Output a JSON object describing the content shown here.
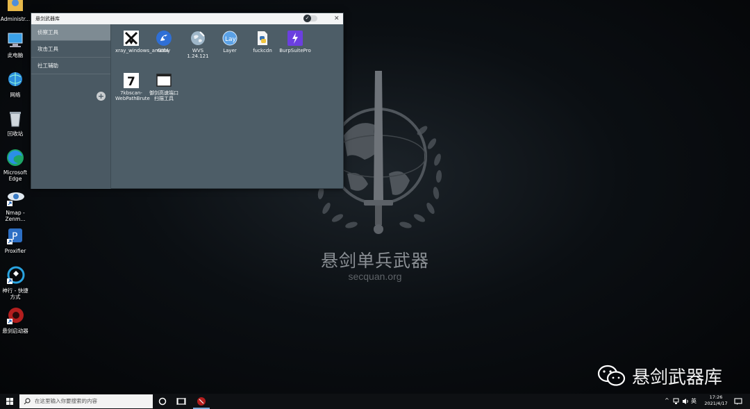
{
  "desktop": {
    "icons": [
      {
        "label": "Administr...",
        "icon": "user-folder-icon"
      },
      {
        "label": "此电脑",
        "icon": "computer-icon"
      },
      {
        "label": "网络",
        "icon": "network-icon"
      },
      {
        "label": "回收站",
        "icon": "recycle-bin-icon"
      },
      {
        "label": "Microsoft Edge",
        "icon": "edge-icon"
      },
      {
        "label": "Nmap - Zenm...",
        "icon": "nmap-eye-icon"
      },
      {
        "label": "Proxifier",
        "icon": "proxifier-icon"
      },
      {
        "label": "神行 - 快捷方式",
        "icon": "shenxing-icon"
      },
      {
        "label": "悬剑启动器",
        "icon": "xuanjian-launcher-icon"
      }
    ],
    "wallpaper": {
      "title": "悬剑单兵武器",
      "subtitle": "secquan.org",
      "watermark": "悬剑武器库"
    }
  },
  "window": {
    "title": "悬剑武器库",
    "close_glyph": "✕",
    "sidebar": {
      "items": [
        {
          "label": "侦察工具",
          "active": true
        },
        {
          "label": "攻击工具",
          "active": false
        },
        {
          "label": "社工辅助",
          "active": false
        }
      ],
      "add_glyph": "+"
    },
    "tools": [
      {
        "label": "xray_windows_amd64",
        "icon": "xray-icon"
      },
      {
        "label": "Goby",
        "icon": "goby-icon"
      },
      {
        "label": "WVS 1.24.121",
        "icon": "wvs-globe-icon"
      },
      {
        "label": "Layer",
        "icon": "layer-icon"
      },
      {
        "label": "fuckcdn",
        "icon": "python-script-icon"
      },
      {
        "label": "BurpSuitePro",
        "icon": "burpsuite-icon"
      },
      {
        "label": "7kbscan-WebPathBrute",
        "icon": "seven-k-icon"
      },
      {
        "label": "御剑高速端口扫描工具",
        "icon": "window-app-icon"
      }
    ]
  },
  "taskbar": {
    "search_placeholder": "在这里输入你要搜索的内容",
    "ime": "英",
    "time": "17:26",
    "date": "2021/4/17"
  },
  "colors": {
    "window_bg": "#4d5d67",
    "sidebar_active": "#7e8b93",
    "burp_purple": "#6b3fe0",
    "goby_blue": "#2f6fd6"
  }
}
